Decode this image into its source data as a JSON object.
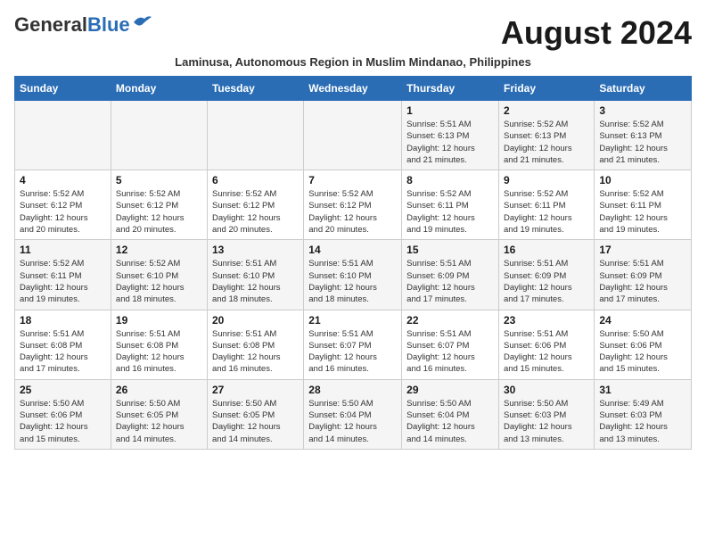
{
  "header": {
    "logo_general": "General",
    "logo_blue": "Blue",
    "month_year": "August 2024",
    "subtitle": "Laminusa, Autonomous Region in Muslim Mindanao, Philippines"
  },
  "weekdays": [
    "Sunday",
    "Monday",
    "Tuesday",
    "Wednesday",
    "Thursday",
    "Friday",
    "Saturday"
  ],
  "weeks": [
    [
      {
        "day": "",
        "info": ""
      },
      {
        "day": "",
        "info": ""
      },
      {
        "day": "",
        "info": ""
      },
      {
        "day": "",
        "info": ""
      },
      {
        "day": "1",
        "info": "Sunrise: 5:51 AM\nSunset: 6:13 PM\nDaylight: 12 hours\nand 21 minutes."
      },
      {
        "day": "2",
        "info": "Sunrise: 5:52 AM\nSunset: 6:13 PM\nDaylight: 12 hours\nand 21 minutes."
      },
      {
        "day": "3",
        "info": "Sunrise: 5:52 AM\nSunset: 6:13 PM\nDaylight: 12 hours\nand 21 minutes."
      }
    ],
    [
      {
        "day": "4",
        "info": "Sunrise: 5:52 AM\nSunset: 6:12 PM\nDaylight: 12 hours\nand 20 minutes."
      },
      {
        "day": "5",
        "info": "Sunrise: 5:52 AM\nSunset: 6:12 PM\nDaylight: 12 hours\nand 20 minutes."
      },
      {
        "day": "6",
        "info": "Sunrise: 5:52 AM\nSunset: 6:12 PM\nDaylight: 12 hours\nand 20 minutes."
      },
      {
        "day": "7",
        "info": "Sunrise: 5:52 AM\nSunset: 6:12 PM\nDaylight: 12 hours\nand 20 minutes."
      },
      {
        "day": "8",
        "info": "Sunrise: 5:52 AM\nSunset: 6:11 PM\nDaylight: 12 hours\nand 19 minutes."
      },
      {
        "day": "9",
        "info": "Sunrise: 5:52 AM\nSunset: 6:11 PM\nDaylight: 12 hours\nand 19 minutes."
      },
      {
        "day": "10",
        "info": "Sunrise: 5:52 AM\nSunset: 6:11 PM\nDaylight: 12 hours\nand 19 minutes."
      }
    ],
    [
      {
        "day": "11",
        "info": "Sunrise: 5:52 AM\nSunset: 6:11 PM\nDaylight: 12 hours\nand 19 minutes."
      },
      {
        "day": "12",
        "info": "Sunrise: 5:52 AM\nSunset: 6:10 PM\nDaylight: 12 hours\nand 18 minutes."
      },
      {
        "day": "13",
        "info": "Sunrise: 5:51 AM\nSunset: 6:10 PM\nDaylight: 12 hours\nand 18 minutes."
      },
      {
        "day": "14",
        "info": "Sunrise: 5:51 AM\nSunset: 6:10 PM\nDaylight: 12 hours\nand 18 minutes."
      },
      {
        "day": "15",
        "info": "Sunrise: 5:51 AM\nSunset: 6:09 PM\nDaylight: 12 hours\nand 17 minutes."
      },
      {
        "day": "16",
        "info": "Sunrise: 5:51 AM\nSunset: 6:09 PM\nDaylight: 12 hours\nand 17 minutes."
      },
      {
        "day": "17",
        "info": "Sunrise: 5:51 AM\nSunset: 6:09 PM\nDaylight: 12 hours\nand 17 minutes."
      }
    ],
    [
      {
        "day": "18",
        "info": "Sunrise: 5:51 AM\nSunset: 6:08 PM\nDaylight: 12 hours\nand 17 minutes."
      },
      {
        "day": "19",
        "info": "Sunrise: 5:51 AM\nSunset: 6:08 PM\nDaylight: 12 hours\nand 16 minutes."
      },
      {
        "day": "20",
        "info": "Sunrise: 5:51 AM\nSunset: 6:08 PM\nDaylight: 12 hours\nand 16 minutes."
      },
      {
        "day": "21",
        "info": "Sunrise: 5:51 AM\nSunset: 6:07 PM\nDaylight: 12 hours\nand 16 minutes."
      },
      {
        "day": "22",
        "info": "Sunrise: 5:51 AM\nSunset: 6:07 PM\nDaylight: 12 hours\nand 16 minutes."
      },
      {
        "day": "23",
        "info": "Sunrise: 5:51 AM\nSunset: 6:06 PM\nDaylight: 12 hours\nand 15 minutes."
      },
      {
        "day": "24",
        "info": "Sunrise: 5:50 AM\nSunset: 6:06 PM\nDaylight: 12 hours\nand 15 minutes."
      }
    ],
    [
      {
        "day": "25",
        "info": "Sunrise: 5:50 AM\nSunset: 6:06 PM\nDaylight: 12 hours\nand 15 minutes."
      },
      {
        "day": "26",
        "info": "Sunrise: 5:50 AM\nSunset: 6:05 PM\nDaylight: 12 hours\nand 14 minutes."
      },
      {
        "day": "27",
        "info": "Sunrise: 5:50 AM\nSunset: 6:05 PM\nDaylight: 12 hours\nand 14 minutes."
      },
      {
        "day": "28",
        "info": "Sunrise: 5:50 AM\nSunset: 6:04 PM\nDaylight: 12 hours\nand 14 minutes."
      },
      {
        "day": "29",
        "info": "Sunrise: 5:50 AM\nSunset: 6:04 PM\nDaylight: 12 hours\nand 14 minutes."
      },
      {
        "day": "30",
        "info": "Sunrise: 5:50 AM\nSunset: 6:03 PM\nDaylight: 12 hours\nand 13 minutes."
      },
      {
        "day": "31",
        "info": "Sunrise: 5:49 AM\nSunset: 6:03 PM\nDaylight: 12 hours\nand 13 minutes."
      }
    ]
  ]
}
